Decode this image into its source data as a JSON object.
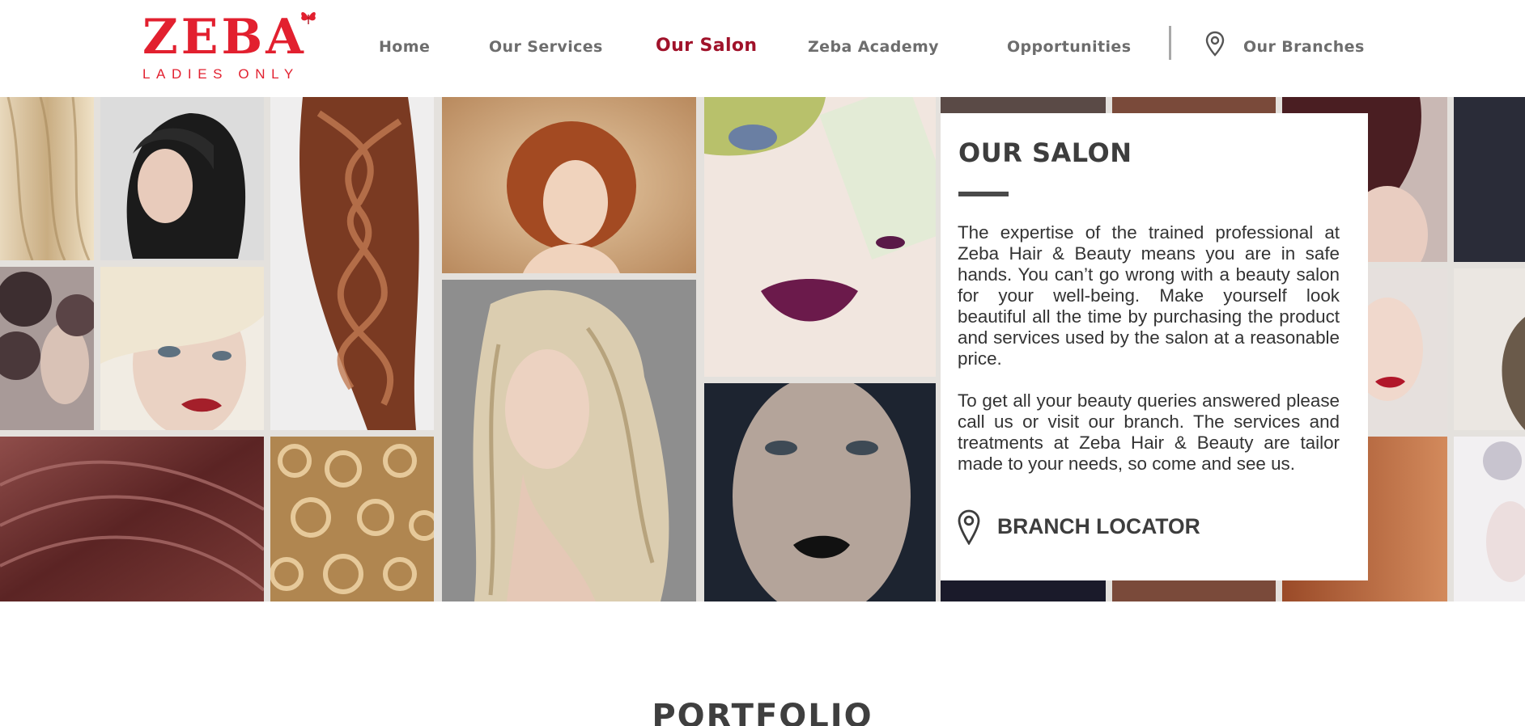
{
  "brand": {
    "name": "ZEBA",
    "tagline": "LADIES ONLY",
    "color": "#e2202f"
  },
  "nav": {
    "items": [
      {
        "label": "Home",
        "active": false
      },
      {
        "label": "Our Services",
        "active": false
      },
      {
        "label": "Our Salon",
        "active": true
      },
      {
        "label": "Zeba Academy",
        "active": false
      },
      {
        "label": "Opportunities",
        "active": false
      }
    ],
    "branches": {
      "label": "Our Branches",
      "icon": "location-pin-icon"
    },
    "active_color": "#a0122a"
  },
  "hero": {
    "photos": [
      "blonde-hair-closeup",
      "black-bob-haircut",
      "copper-braid",
      "curly-red-hair",
      "green-eyeshadow-purple-lips",
      "dark-curls",
      "platinum-fringe-red-lips",
      "long-platinum-waves",
      "burgundy-hair-closeup",
      "blonde-curls-closeup",
      "freckled-face-black-lips",
      "dark-auburn-bob",
      "red-lips-pin-up",
      "auburn-hair-closeup",
      "silver-headpiece"
    ]
  },
  "card": {
    "title": "OUR SALON",
    "paragraph1": "The expertise of the trained professional at Zeba Hair & Beauty means you are in safe hands. You can’t go wrong with a beauty salon for your well-being. Make yourself look beautiful all the time by purchasing the product and services used by the salon at a reasonable price.",
    "paragraph2": "To get all your beauty queries answered please call us or visit our branch. The services and treatments at Zeba Hair & Beauty are tailor made to your needs, so come and see us.",
    "locator_label": "BRANCH LOCATOR",
    "locator_icon": "location-pin-icon"
  },
  "portfolio": {
    "heading": "PORTFOLIO"
  }
}
